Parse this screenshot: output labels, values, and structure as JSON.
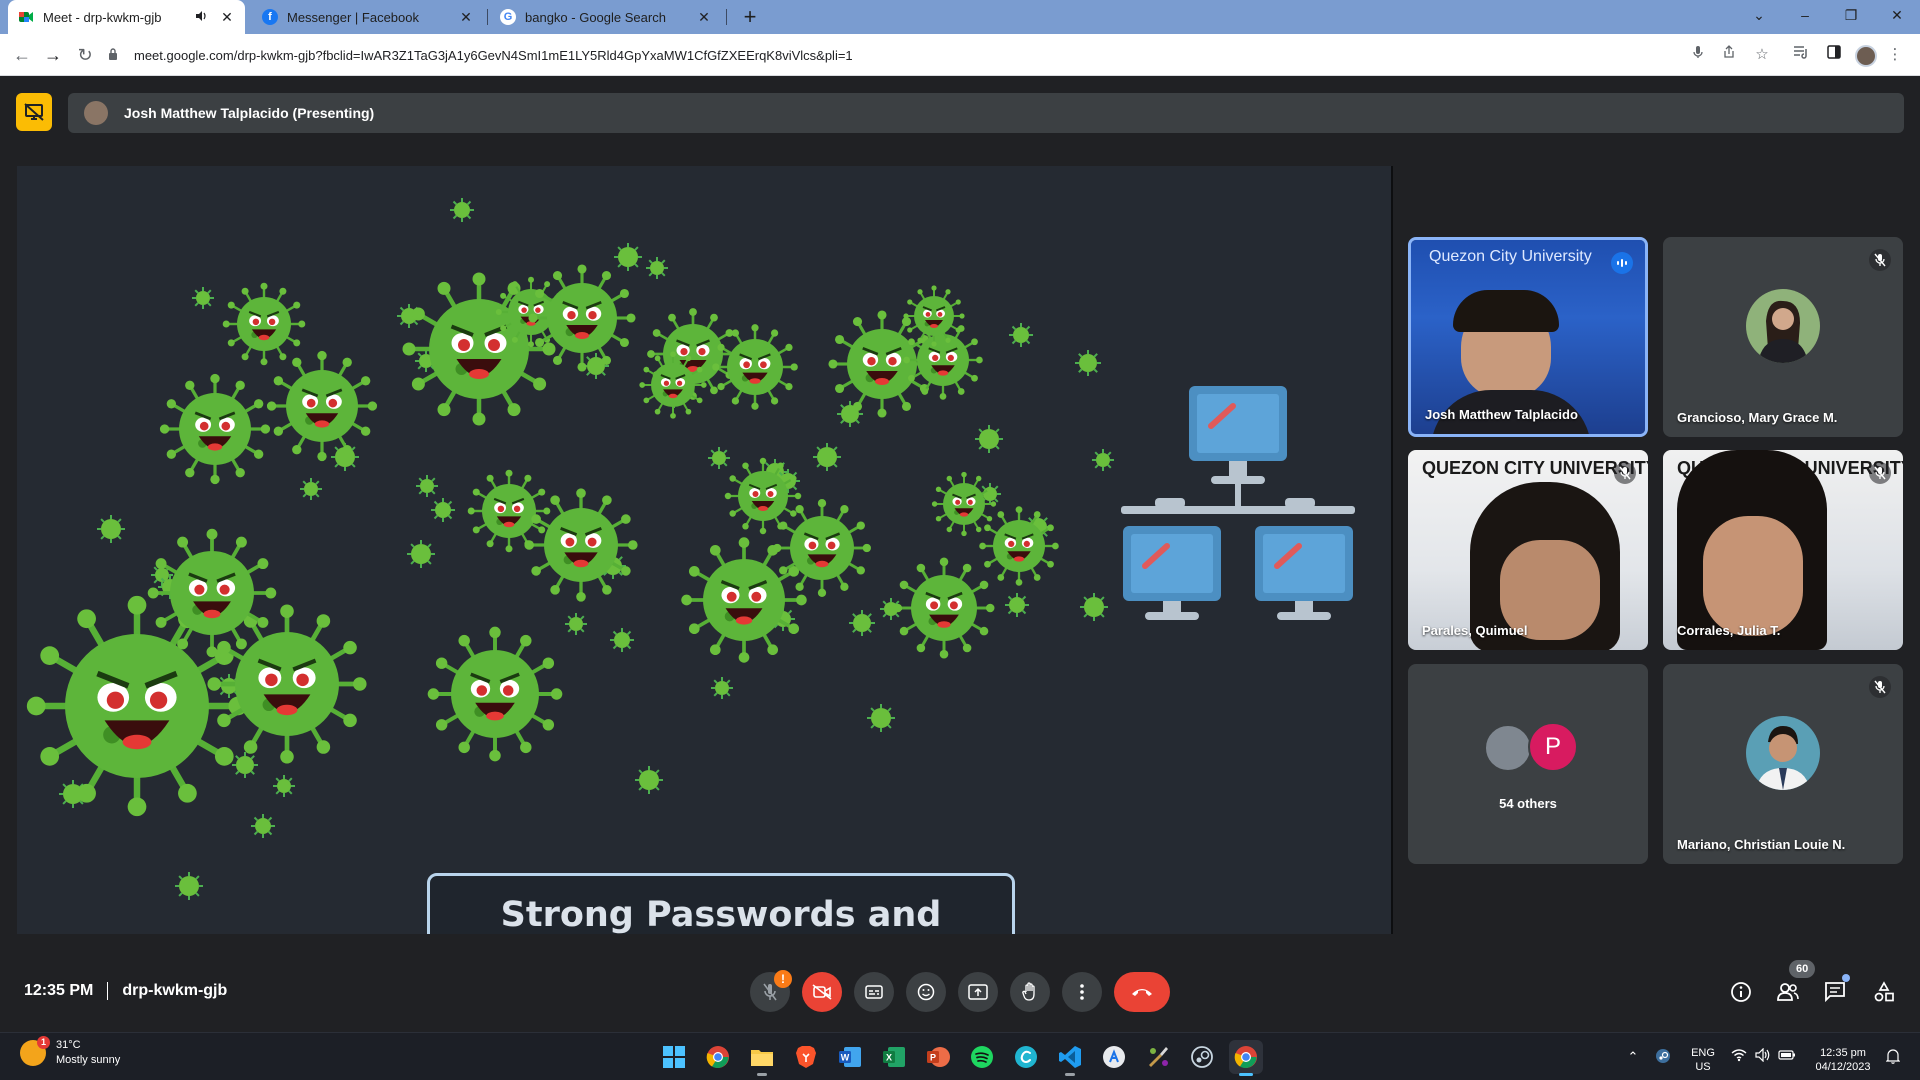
{
  "browser": {
    "tabs": [
      {
        "title": "Meet - drp-kwkm-gjb",
        "icon": "google-meet-icon",
        "audio": true
      },
      {
        "title": "Messenger | Facebook",
        "icon": "facebook-icon"
      },
      {
        "title": "bangko - Google Search",
        "icon": "google-icon"
      }
    ],
    "url": "meet.google.com/drp-kwkm-gjb?fbclid=IwAR3Z1TaG3jA1y6GevN4SmI1mE1LY5Rld4GpYxaMW1CfGfZXEErqK8viVlcs&pli=1"
  },
  "meet": {
    "presenter_label": "Josh Matthew Talplacido (Presenting)",
    "slide": {
      "title": "Strong Passwords and Multi-Factor Authentication"
    },
    "participants": [
      {
        "name": "Josh Matthew Talplacido",
        "state": "speaking",
        "banner": "Quezon City University"
      },
      {
        "name": "Grancioso, Mary Grace M.",
        "state": "muted"
      },
      {
        "name": "Parales, Quimuel",
        "state": "muted",
        "banner": "QUEZON CITY UNIVERSITY"
      },
      {
        "name": "Corrales, Julia T.",
        "state": "muted",
        "banner": "QUEZON CITY UNIVERSITY"
      },
      {
        "name": "54 others",
        "state": "group",
        "avatar_letter": "P"
      },
      {
        "name": "Mariano, Christian Louie N.",
        "state": "muted"
      }
    ],
    "bottom": {
      "time": "12:35 PM",
      "meeting_code": "drp-kwkm-gjb",
      "mic_alert": "!",
      "people_count": "60"
    },
    "colors": {
      "accent": "#8ab4f8",
      "danger": "#ea4335",
      "present": "#fbbc04"
    }
  },
  "taskbar": {
    "weather_temp": "31°C",
    "weather_desc": "Mostly sunny",
    "weather_badge": "1",
    "lang_top": "ENG",
    "lang_bottom": "US",
    "clock_time": "12:35 pm",
    "clock_date": "04/12/2023"
  }
}
